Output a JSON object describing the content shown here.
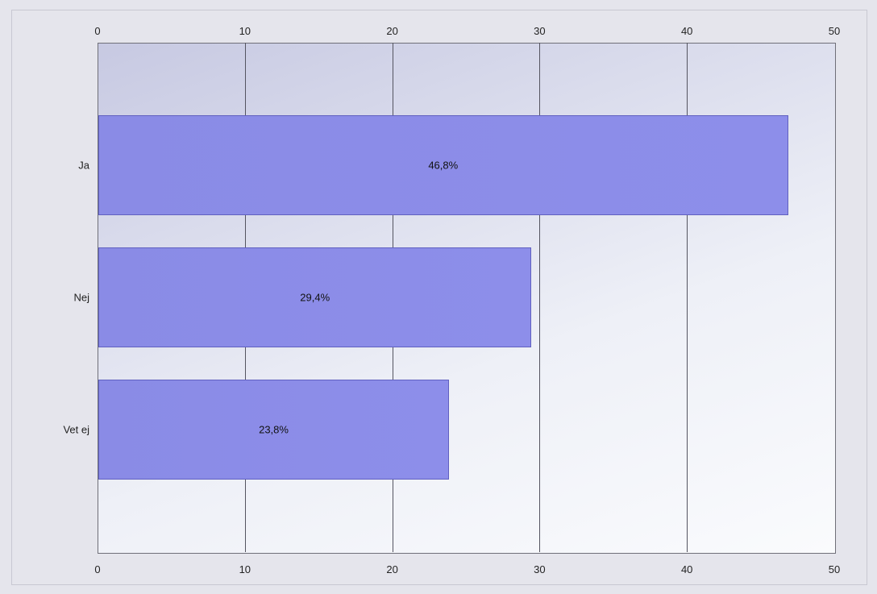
{
  "chart_data": {
    "type": "bar",
    "orientation": "horizontal",
    "categories": [
      "Ja",
      "Nej",
      "Vet ej"
    ],
    "values": [
      46.8,
      29.4,
      23.8
    ],
    "value_labels": [
      "46,8%",
      "29,4%",
      "23,8%"
    ],
    "xlim": [
      0,
      50
    ],
    "xticks": [
      0,
      10,
      20,
      30,
      40,
      50
    ],
    "xtick_labels": [
      "0",
      "10",
      "20",
      "30",
      "40",
      "50"
    ],
    "title": "",
    "xlabel": "",
    "ylabel": ""
  }
}
